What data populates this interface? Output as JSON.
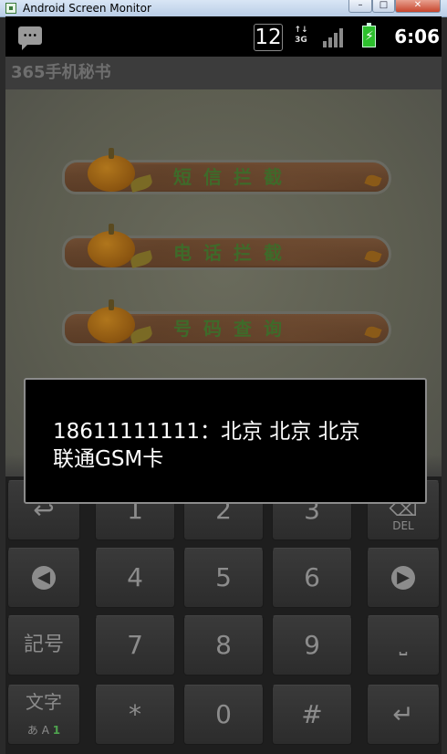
{
  "window": {
    "title": "Android Screen Monitor"
  },
  "statusbar": {
    "notification_icon": "sms-icon",
    "badge_number": "12",
    "network": "3G",
    "signal_icon": "signal-icon",
    "battery_icon": "battery-charging-icon",
    "time": "6:06"
  },
  "app": {
    "title": "365手机秘书",
    "menu": [
      {
        "label": "短信拦截"
      },
      {
        "label": "电话拦截"
      },
      {
        "label": "号码查询"
      }
    ]
  },
  "toast": {
    "line1": "18611111111：北京 北京 北京",
    "line2": "联通GSM卡"
  },
  "keyboard": {
    "rows": [
      [
        "↩",
        "1",
        "2",
        "3",
        "DEL"
      ],
      [
        "◀",
        "4",
        "5",
        "6",
        "▶"
      ],
      [
        "記号",
        "7",
        "8",
        "9",
        "␣"
      ],
      [
        "文字",
        "*",
        "0",
        "#",
        "↵"
      ]
    ],
    "mode_sub": "あ A",
    "mode_sub_num": "1",
    "del_label": "DEL"
  }
}
